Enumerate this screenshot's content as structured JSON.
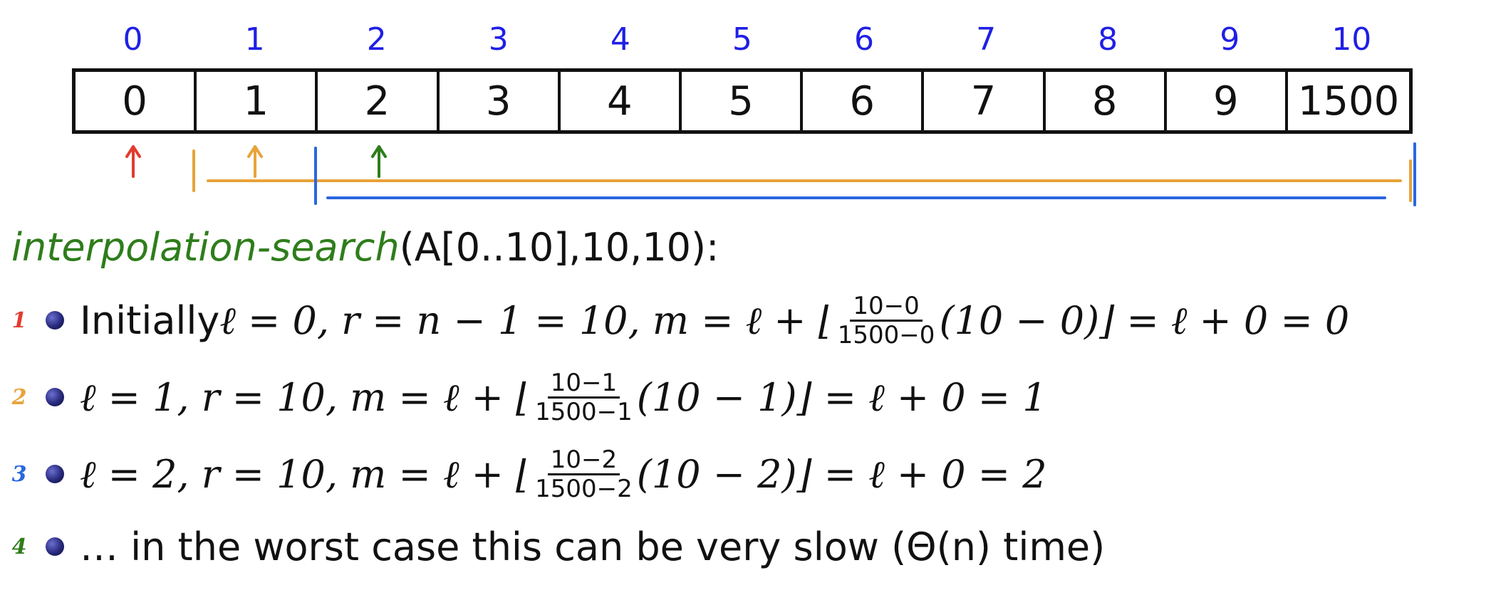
{
  "array": {
    "indices": [
      "0",
      "1",
      "2",
      "3",
      "4",
      "5",
      "6",
      "7",
      "8",
      "9",
      "10"
    ],
    "values": [
      "0",
      "1",
      "2",
      "3",
      "4",
      "5",
      "6",
      "7",
      "8",
      "9",
      "1500"
    ]
  },
  "colors": {
    "index": "#1f1fe6",
    "step1": "#e23b2e",
    "step2": "#e8a33a",
    "step3": "#2a67e0",
    "step4": "#2e7d1b",
    "function": "#2e7d1b"
  },
  "call": {
    "fn": "interpolation-search",
    "args": "(A[0..10],10,10):"
  },
  "steps": [
    {
      "marker": "1",
      "pre": "Initially ",
      "vars": "ℓ = 0,  r = n − 1 = 10,  m = ℓ + ⌊",
      "frac_num": "10−0",
      "frac_den": "1500−0",
      "post": "(10 − 0)⌋ = ℓ + 0 = 0"
    },
    {
      "marker": "2",
      "pre": "",
      "vars": "ℓ = 1,  r = 10,  m = ℓ + ⌊",
      "frac_num": "10−1",
      "frac_den": "1500−1",
      "post": "(10 − 1)⌋ = ℓ + 0 = 1"
    },
    {
      "marker": "3",
      "pre": "",
      "vars": "ℓ = 2,  r = 10,  m = ℓ + ⌊",
      "frac_num": "10−2",
      "frac_den": "1500−2",
      "post": "(10 − 2)⌋ = ℓ + 0 = 2"
    },
    {
      "marker": "4",
      "text": "… in the worst case this can be very slow (Θ(n) time)"
    }
  ]
}
